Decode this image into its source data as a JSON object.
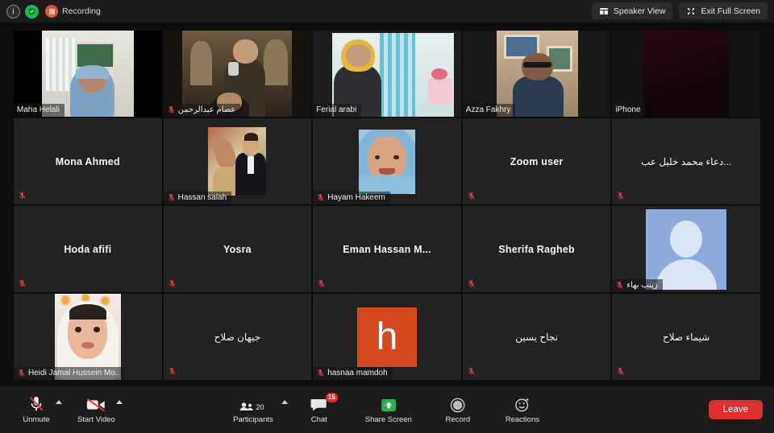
{
  "topbar": {
    "info_icon": "info-icon",
    "shield_icon": "encryption-shield-icon",
    "recording_label": "Recording",
    "speaker_view_label": "Speaker View",
    "exit_full_screen_label": "Exit Full Screen"
  },
  "gallery": {
    "columns": 5,
    "rows": 4,
    "active_speaker_border_color": "#d9e64a",
    "tiles": [
      {
        "name": "Maha Helali",
        "display": "bottom",
        "media": "video",
        "muted": false,
        "active": true,
        "rtl": false
      },
      {
        "name": "عصام عبدالرحمن",
        "display": "bottom",
        "media": "photo",
        "muted": true,
        "active": false,
        "rtl": true
      },
      {
        "name": "Ferial arabi",
        "display": "bottom",
        "media": "video",
        "muted": false,
        "active": false,
        "rtl": false
      },
      {
        "name": "Azza Fakhry",
        "display": "bottom",
        "media": "video",
        "muted": false,
        "active": false,
        "rtl": false
      },
      {
        "name": "iPhone",
        "display": "bottom",
        "media": "video-dark",
        "muted": false,
        "active": false,
        "rtl": false
      },
      {
        "name": "Mona Ahmed",
        "display": "center",
        "media": "none",
        "muted": true,
        "active": false,
        "rtl": false
      },
      {
        "name": "Hassan salah",
        "display": "bottom",
        "media": "photo",
        "muted": true,
        "active": false,
        "rtl": false
      },
      {
        "name": "Hayam Hakeem",
        "display": "bottom",
        "media": "photo",
        "muted": true,
        "active": false,
        "rtl": false
      },
      {
        "name": "Zoom user",
        "display": "center",
        "media": "none",
        "muted": true,
        "active": false,
        "rtl": false
      },
      {
        "name": "...دعاء محمد خليل عب",
        "display": "center",
        "media": "none",
        "muted": true,
        "active": false,
        "rtl": true
      },
      {
        "name": "Hoda afifi",
        "display": "center",
        "media": "none",
        "muted": true,
        "active": false,
        "rtl": false
      },
      {
        "name": "Yosra",
        "display": "center",
        "media": "none",
        "muted": true,
        "active": false,
        "rtl": false
      },
      {
        "name": "Eman  Hassan M...",
        "display": "center",
        "media": "none",
        "muted": true,
        "active": false,
        "rtl": false
      },
      {
        "name": "Sherifa Ragheb",
        "display": "center",
        "media": "none",
        "muted": true,
        "active": false,
        "rtl": false
      },
      {
        "name": "زينب بهاء",
        "display": "bottom",
        "media": "avatar",
        "muted": true,
        "active": false,
        "rtl": true
      },
      {
        "name": "Heidi Jamal Hussein Mo..",
        "display": "bottom",
        "media": "photo",
        "muted": true,
        "active": false,
        "rtl": false
      },
      {
        "name": "جيهان صلاح",
        "display": "center",
        "media": "none",
        "muted": true,
        "active": false,
        "rtl": true
      },
      {
        "name": "hasnaa mamdoh",
        "display": "bottom",
        "media": "letter",
        "letter": "h",
        "muted": true,
        "active": false,
        "rtl": false
      },
      {
        "name": "نجاح يسين",
        "display": "center",
        "media": "none",
        "muted": true,
        "active": false,
        "rtl": true
      },
      {
        "name": "شيماء صلاح",
        "display": "center",
        "media": "none",
        "muted": true,
        "active": false,
        "rtl": true
      }
    ]
  },
  "controls": {
    "unmute_label": "Unmute",
    "start_video_label": "Start Video",
    "participants_label": "Participants",
    "participants_count": "20",
    "chat_label": "Chat",
    "chat_badge": "15",
    "share_screen_label": "Share Screen",
    "record_label": "Record",
    "reactions_label": "Reactions",
    "leave_label": "Leave"
  },
  "colors": {
    "accent_red": "#e02d2d",
    "share_green": "#2bb14c",
    "active_border": "#d9e64a",
    "recording_red": "#e8503a"
  }
}
